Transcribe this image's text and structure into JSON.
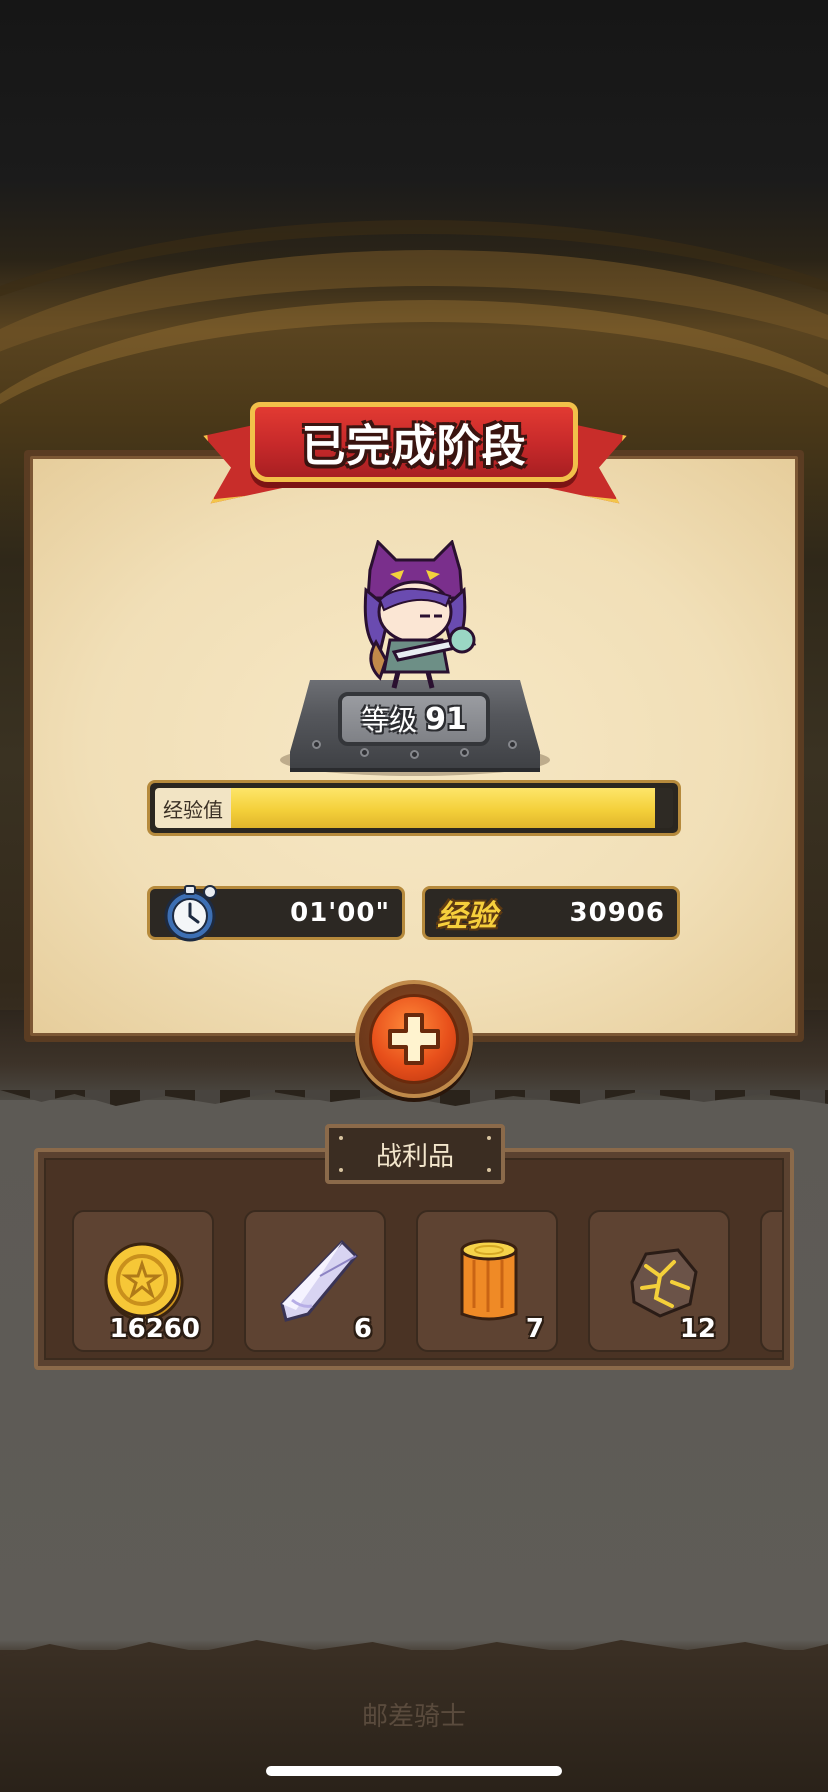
{
  "banner": {
    "title": "已完成阶段"
  },
  "hero": {
    "level_label": "等级",
    "level_value": "91"
  },
  "exp_bar": {
    "label": "经验值",
    "fill_fraction": 0.96
  },
  "stats": {
    "time_value": "01'00\"",
    "exp_label": "经验",
    "exp_value": "30906"
  },
  "loot": {
    "title": "战利品",
    "items": [
      {
        "icon": "gold-coin-icon",
        "count": "16260"
      },
      {
        "icon": "crystal-shard-icon",
        "count": "6"
      },
      {
        "icon": "wood-log-icon",
        "count": "7"
      },
      {
        "icon": "ore-stone-icon",
        "count": "12"
      }
    ]
  },
  "footer": {
    "text": "邮差骑士"
  },
  "colors": {
    "banner_red": "#c82d2a",
    "banner_gold": "#f2c04a",
    "exp_yellow": "#f4d03a",
    "plus_orange": "#e8501b"
  }
}
